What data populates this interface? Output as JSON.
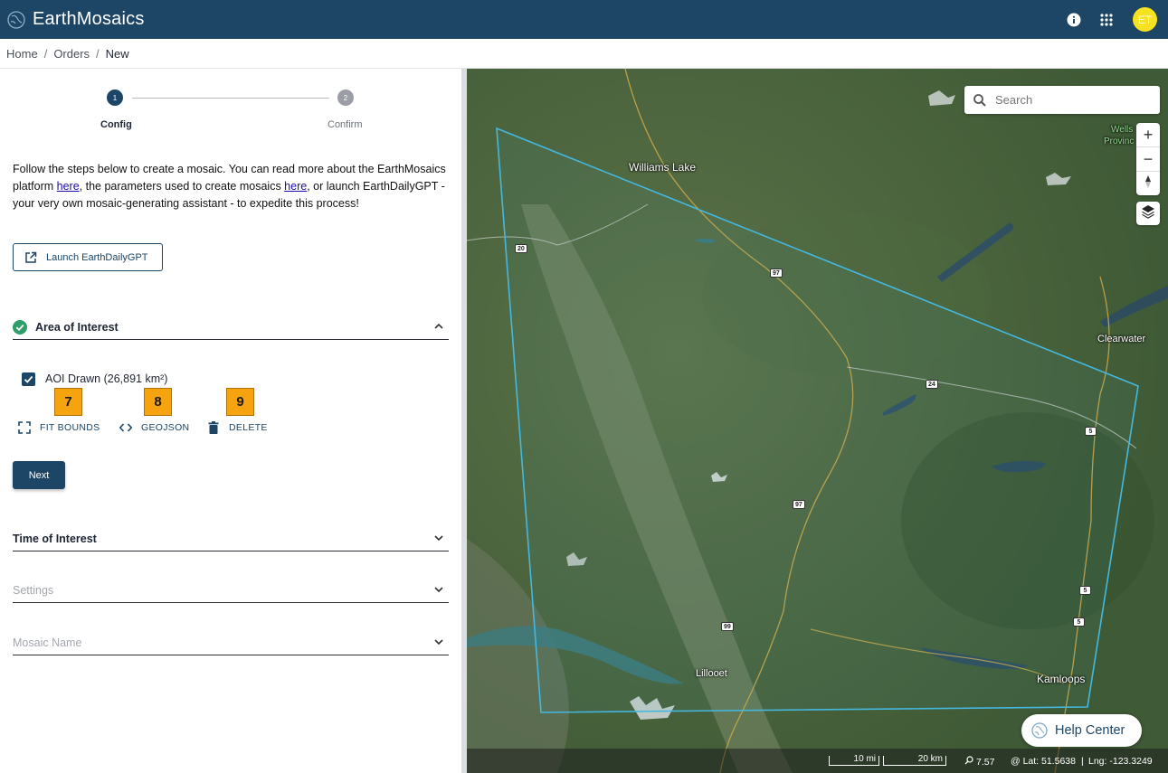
{
  "header": {
    "app_title": "EarthMosaics",
    "logo_icon": "earth-logo-icon",
    "info_icon": "info-icon",
    "apps_icon": "apps-grid-icon",
    "avatar_initials": "ET",
    "avatar_color": "#f6e21f",
    "brand_color": "#1d4565"
  },
  "breadcrumb": {
    "items": [
      "Home",
      "Orders",
      "New"
    ],
    "separator": "/"
  },
  "stepper": {
    "steps": [
      {
        "number": "1",
        "label": "Config",
        "active": true
      },
      {
        "number": "2",
        "label": "Confirm",
        "active": false
      }
    ]
  },
  "intro": {
    "part1": "Follow the steps below to create a mosaic. You can read more about the EarthMosaics platform ",
    "link1": "here",
    "part2": ", the parameters used to create mosaics ",
    "link2": "here",
    "part3": ", or launch EarthDailyGPT - your very own mosaic-generating assistant - to expedite this process!"
  },
  "launch_button": {
    "label": "Launch EarthDailyGPT",
    "icon": "external-link-icon"
  },
  "area_of_interest": {
    "title": "Area of Interest",
    "completed": true,
    "aoi_label": "AOI Drawn (26,891 km²)",
    "aoi_checked": true,
    "badges": [
      "7",
      "8",
      "9"
    ],
    "actions": {
      "fit_bounds": "FIT BOUNDS",
      "geojson": "GEOJSON",
      "delete": "DELETE"
    },
    "next_label": "Next"
  },
  "sections": {
    "time_of_interest": "Time of Interest",
    "settings": "Settings",
    "mosaic_name": "Mosaic Name"
  },
  "map": {
    "search_placeholder": "Search",
    "zoom_in": "+",
    "zoom_out": "−",
    "labels": {
      "williams_lake": "Williams Lake",
      "clearwater": "Clearwater",
      "lillooet": "Lillooet",
      "kamloops": "Kamloops",
      "wells_gray": "Wells",
      "wells_gray2": "Provinc"
    },
    "shields": [
      "20",
      "97",
      "24",
      "5",
      "97",
      "5",
      "5",
      "99"
    ],
    "polygon_color": "#45b8e0",
    "help_center": "Help Center",
    "status": {
      "scale_mi": "10 mi",
      "scale_km": "20 km",
      "zoom": "7.57",
      "lat": "@ Lat: 51.5638",
      "lng": "Lng: -123.3249",
      "sep": "|"
    }
  }
}
